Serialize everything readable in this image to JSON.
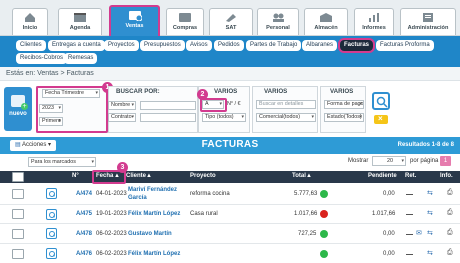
{
  "modules": [
    {
      "label": "Inicio",
      "icon": "home-icon"
    },
    {
      "label": "Agenda",
      "icon": "calendar-icon"
    },
    {
      "label": "Ventas",
      "icon": "sales-icon"
    },
    {
      "label": "Compras",
      "icon": "purchases-icon"
    },
    {
      "label": "SAT",
      "icon": "tools-icon"
    },
    {
      "label": "Personal",
      "icon": "people-icon"
    },
    {
      "label": "Almacén",
      "icon": "warehouse-icon"
    },
    {
      "label": "Informes",
      "icon": "reports-icon"
    },
    {
      "label": "Administración",
      "icon": "admin-icon"
    }
  ],
  "submenu": [
    "Clientes",
    "Entregas a cuenta",
    "Proyectos",
    "Presupuestos",
    "Avisos",
    "Pedidos",
    "Partes de Trabajo",
    "Albaranes",
    "Facturas",
    "Facturas Proforma",
    "Recibos-Cobros",
    "Remesas"
  ],
  "breadcrumb": "Estás en: Ventas > Facturas",
  "new_button": "nuevo",
  "filters": {
    "period_select": "Fecha Trimestre",
    "year_select": "2023",
    "quarter_select": "Primero",
    "buscar_por_title": "BUSCAR POR:",
    "field1": "Nombre",
    "field2": "Contrato",
    "varios1_title": "VARIOS",
    "varios1_select1": "A",
    "varios1_select1_suffix": "N° / €",
    "varios1_select2": "Tipo (todos)",
    "varios2_title": "VARIOS",
    "varios2_search": "Buscar en detalles",
    "varios2_select": "Comercial(todos)",
    "varios3_title": "VARIOS",
    "varios3_select1": "Forma de pago",
    "varios3_select2": "Estado(Todos)"
  },
  "callouts": [
    "1",
    "2",
    "3"
  ],
  "results": {
    "actions_label": "Acciones",
    "title": "FACTURAS",
    "count_text": "Resultados 1-8 de 8",
    "marked_select": "Para los marcados",
    "mostrar_label": "Mostrar",
    "per_page": "20",
    "por_pagina_label": "por página",
    "page": "1"
  },
  "table": {
    "headers": {
      "num": "N°",
      "fecha": "Fecha",
      "cliente": "Cliente",
      "proyecto": "Proyecto",
      "total": "Total",
      "pendiente": "Pendiente",
      "ret": "Ret.",
      "info": "Info."
    },
    "rows": [
      {
        "num": "A/474",
        "fecha": "04-01-2023",
        "cliente": "Mariví Fernández García",
        "proyecto": "reforma cocina",
        "total": "5.777,63",
        "pendiente": "0,00",
        "status_color": "#2db84a"
      },
      {
        "num": "A/475",
        "fecha": "19-01-2023",
        "cliente": "Félix Martín López",
        "proyecto": "Casa rural",
        "total": "1.017,66",
        "pendiente": "1.017,66",
        "status_color": "#d9231e"
      },
      {
        "num": "A/478",
        "fecha": "06-02-2023",
        "cliente": "Gustavo Martín",
        "proyecto": "",
        "total": "727,25",
        "pendiente": "0,00",
        "status_color": "#2db84a"
      },
      {
        "num": "A/476",
        "fecha": "06-02-2023",
        "cliente": "Félix Martín López",
        "proyecto": "",
        "total": "",
        "pendiente": "0,00",
        "status_color": "#2db84a"
      }
    ]
  }
}
